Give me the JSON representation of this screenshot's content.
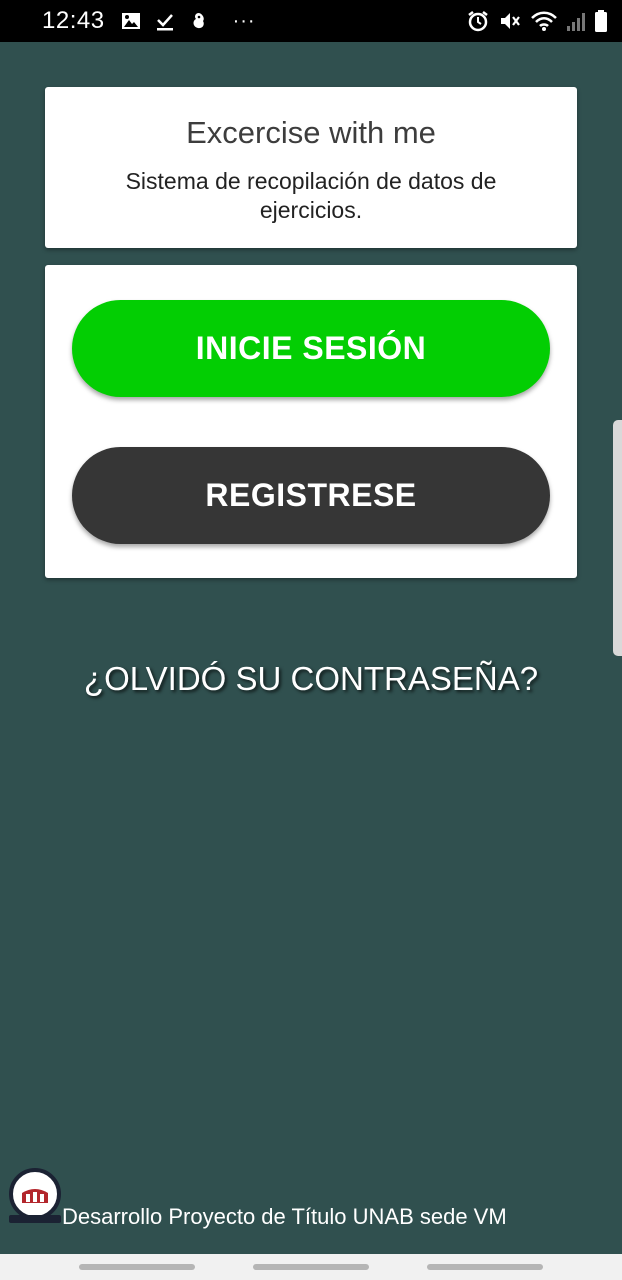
{
  "status_bar": {
    "time": "12:43",
    "left_icons": [
      "image-icon",
      "download-done-icon",
      "bird-icon"
    ],
    "more": "···",
    "right_icons": [
      "alarm-icon",
      "mute-icon",
      "wifi-icon",
      "signal-icon",
      "battery-icon"
    ]
  },
  "header": {
    "title": "Excercise with me",
    "subtitle": "Sistema de recopilación de datos de ejercicios."
  },
  "actions": {
    "login_label": "INICIE SESIÓN",
    "register_label": "REGISTRESE",
    "login_color": "#03ce03",
    "register_color": "#363636"
  },
  "forgot_password": "¿OLVIDÓ SU CONTRASEÑA?",
  "footer": {
    "text": "Desarrollo Proyecto de Título UNAB sede VM",
    "logo_icon": "university-logo-icon"
  },
  "colors": {
    "background": "#30504f",
    "accent_green": "#03ce03",
    "dark_button": "#363636"
  }
}
